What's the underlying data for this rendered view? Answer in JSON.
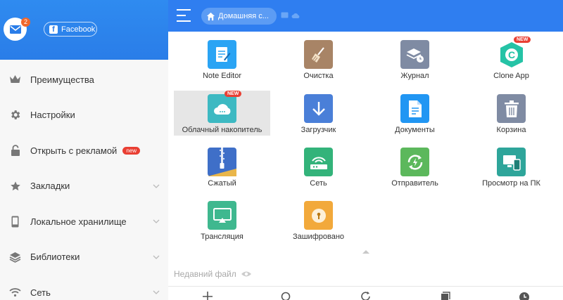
{
  "drawer": {
    "mail_badge": "2",
    "facebook_label": "Facebook",
    "items": [
      {
        "label": "Преимущества",
        "icon": "crown-icon"
      },
      {
        "label": "Настройки",
        "icon": "gear-icon"
      },
      {
        "label": "Открыть с рекламой",
        "icon": "lock-icon",
        "badge": "new"
      },
      {
        "label": "Закладки",
        "icon": "star-icon"
      },
      {
        "label": "Локальное хранилище",
        "icon": "phone-icon"
      },
      {
        "label": "Библиотеки",
        "icon": "layers-icon"
      },
      {
        "label": "Сеть",
        "icon": "wifi-icon"
      }
    ]
  },
  "topbar": {
    "breadcrumb": "Домашняя с..."
  },
  "tiles": [
    {
      "label": "Note Editor",
      "icon": "note-editor-icon",
      "color": "#2aa4f4"
    },
    {
      "label": "Очистка",
      "icon": "broom-icon",
      "color": "#a88466"
    },
    {
      "label": "Журнал",
      "icon": "journal-icon",
      "color": "#7f8ba3"
    },
    {
      "label": "Clone App",
      "icon": "clone-app-icon",
      "color": "#ffffff",
      "badge": "NEW"
    },
    {
      "label": "Облачный накопитель",
      "icon": "cloud-icon",
      "color": "#3db9c2",
      "badge": "NEW"
    },
    {
      "label": "Загрузчик",
      "icon": "download-icon",
      "color": "#4a7fd8"
    },
    {
      "label": "Документы",
      "icon": "document-icon",
      "color": "#2196f3"
    },
    {
      "label": "Корзина",
      "icon": "trash-icon",
      "color": "#7f8ba3"
    },
    {
      "label": "Сжатый",
      "icon": "zip-icon",
      "color": "#3f6fc8"
    },
    {
      "label": "Сеть",
      "icon": "network-icon",
      "color": "#33b37a"
    },
    {
      "label": "Отправитель",
      "icon": "sender-icon",
      "color": "#5cb85c"
    },
    {
      "label": "Просмотр на ПК",
      "icon": "pc-view-icon",
      "color": "#2ea59a"
    },
    {
      "label": "Трансляция",
      "icon": "cast-icon",
      "color": "#3fb88f"
    },
    {
      "label": "Зашифровано",
      "icon": "encrypted-icon",
      "color": "#f2a93b"
    }
  ],
  "recent_label": "Недавний файл",
  "colors": {
    "header_blue": "#2f7ef0",
    "badge_red": "#e93f33"
  }
}
